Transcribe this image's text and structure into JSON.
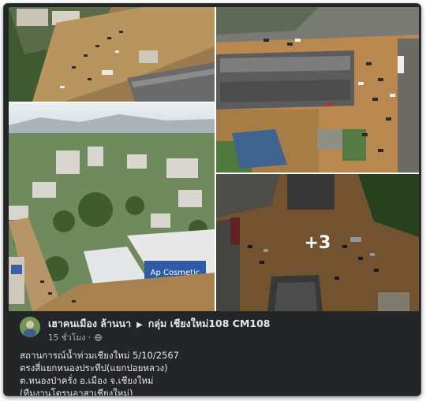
{
  "post": {
    "author_name": "เฮาคนเมือง ล้านนา",
    "arrow_icon": "caret-right-icon",
    "group_name": "กลุ่ม เชียงใหม่108 CM108",
    "time": "15 ชั่วโมง",
    "audience_icon": "globe-icon",
    "lines": [
      "สถานการณ์น้ำท่วมเชียงใหม่ 5/10/2567",
      "ตรงสี่แยกหนองประทีป(แยกปอยหลวง)",
      "ต.หนองป่าครั่ง อ.เมือง จ.เชียงใหม่",
      "(ทีมงานโดรนอาสาเชียงใหม่)"
    ]
  },
  "photos": {
    "more_count": "+3",
    "billboard_text": "Ap Cosmetic"
  }
}
